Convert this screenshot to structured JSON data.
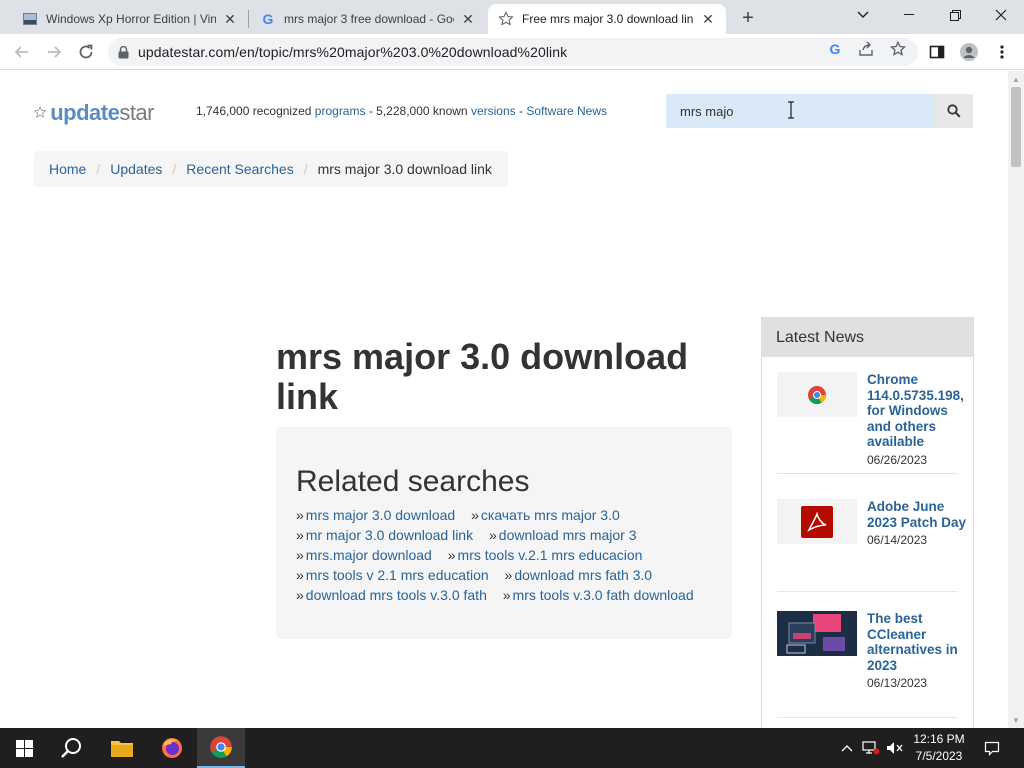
{
  "browser": {
    "tabs": [
      {
        "title": "Windows Xp Horror Edition | Vin",
        "favicon": "image-favicon"
      },
      {
        "title": "mrs major 3 free download - Goo",
        "favicon": "google-favicon"
      },
      {
        "title": "Free mrs major 3.0 download lin",
        "favicon": "updatestar-favicon"
      }
    ],
    "url": "updatestar.com/en/topic/mrs%20major%203.0%20download%20link"
  },
  "site": {
    "logo": {
      "part1": "update",
      "part2": "star"
    },
    "stats": {
      "programs_count": "1,746,000",
      "recognized": "recognized",
      "programs_link": "programs",
      "dash1": "-",
      "versions_count": "5,228,000",
      "known": "known",
      "versions_link": "versions",
      "dash2": "-",
      "news_link": "Software News"
    },
    "search": {
      "value": "mrs majo"
    },
    "breadcrumb": [
      {
        "label": "Home"
      },
      {
        "label": "Updates"
      },
      {
        "label": "Recent Searches"
      },
      {
        "label": "mrs major 3.0 download link"
      }
    ],
    "page_title": "mrs major 3.0 download link",
    "related": {
      "heading": "Related searches",
      "rows": [
        [
          "mrs major 3.0 download",
          "скачать mrs major 3.0"
        ],
        [
          "mr major 3.0 download link",
          "download mrs major 3"
        ],
        [
          "mrs.major download",
          "mrs tools v.2.1 mrs educacion"
        ],
        [
          "mrs tools v 2.1 mrs education",
          "download mrs fath 3.0"
        ],
        [
          "download mrs tools v.3.0 fath",
          "mrs tools v.3.0 fath download"
        ]
      ]
    },
    "news": {
      "heading": "Latest News",
      "items": [
        {
          "title": "Chrome 114.0.5735.198, for Windows and others available",
          "date": "06/26/2023"
        },
        {
          "title": "Adobe June 2023 Patch Day",
          "date": "06/14/2023"
        },
        {
          "title": "The best CCleaner alternatives in 2023",
          "date": "06/13/2023"
        }
      ]
    }
  },
  "taskbar": {
    "time": "12:16 PM",
    "date": "7/5/2023"
  },
  "colors": {
    "link": "#2a6496",
    "search_bg": "#d9e9f7",
    "news_head_bg": "#e0e0e0",
    "taskbar": "#1f1f1f"
  }
}
